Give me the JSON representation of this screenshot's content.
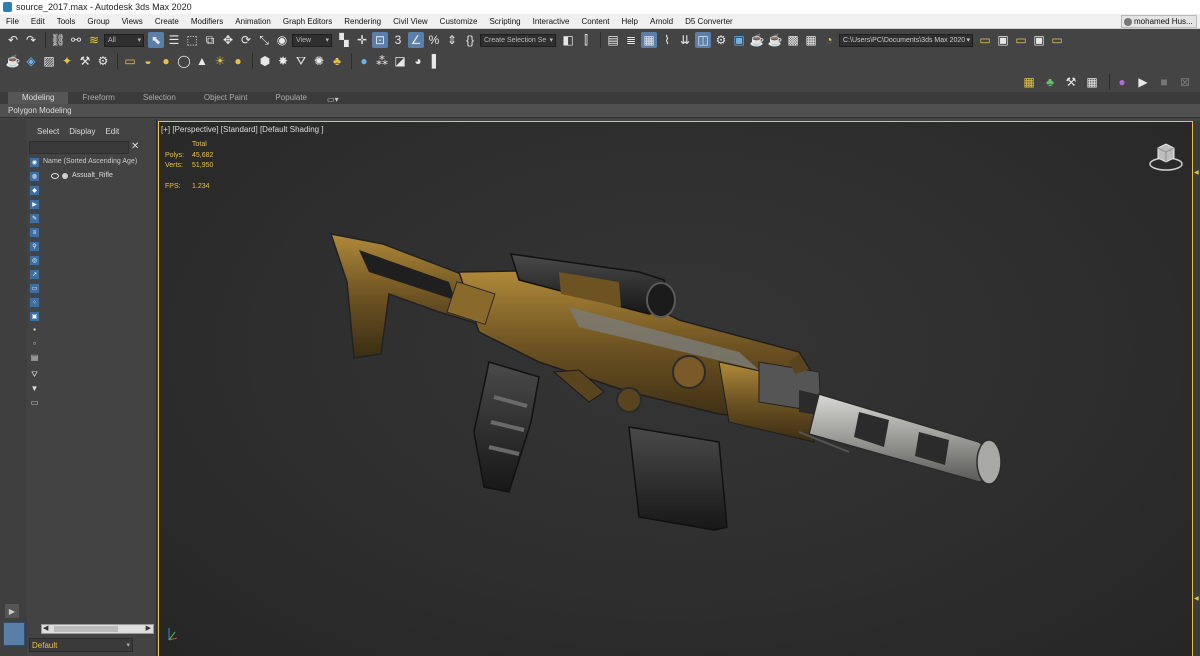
{
  "window": {
    "title": "source_2017.max - Autodesk 3ds Max 2020"
  },
  "menu": {
    "items": [
      "File",
      "Edit",
      "Tools",
      "Group",
      "Views",
      "Create",
      "Modifiers",
      "Animation",
      "Graph Editors",
      "Rendering",
      "Civil View",
      "Customize",
      "Scripting",
      "Interactive",
      "Content",
      "Help",
      "Arnold",
      "D5 Converter"
    ],
    "user": "mohamed Hus..."
  },
  "toolbar": {
    "filter_value": "All",
    "view_value": "View",
    "selection_set_placeholder": "Create Selection Se",
    "project_path": "C:\\Users\\PC\\Documents\\3ds Max 2020"
  },
  "ribbon": {
    "tabs": [
      "Modeling",
      "Freeform",
      "Selection",
      "Object Paint",
      "Populate"
    ],
    "active_tab": "Modeling",
    "panel_label": "Polygon Modeling"
  },
  "explorer": {
    "menu": [
      "Select",
      "Display",
      "Edit"
    ],
    "column_header": "Name (Sorted Ascending Age)",
    "objects": [
      "Assualt_Rifle"
    ],
    "layer": "Default"
  },
  "viewport": {
    "label": "[+] [Perspective] [Standard] [Default Shading ]",
    "stats": {
      "header": "Total",
      "polys_label": "Polys:",
      "polys_value": "45,682",
      "verts_label": "Verts:",
      "verts_value": "51,950",
      "fps_label": "FPS:",
      "fps_value": "1.234"
    }
  },
  "colors": {
    "accent_yellow": "#e7c24a",
    "viewport_bg": "#2e2e2e",
    "ui_bg": "#444444",
    "highlight_blue": "#5b7fa8"
  }
}
